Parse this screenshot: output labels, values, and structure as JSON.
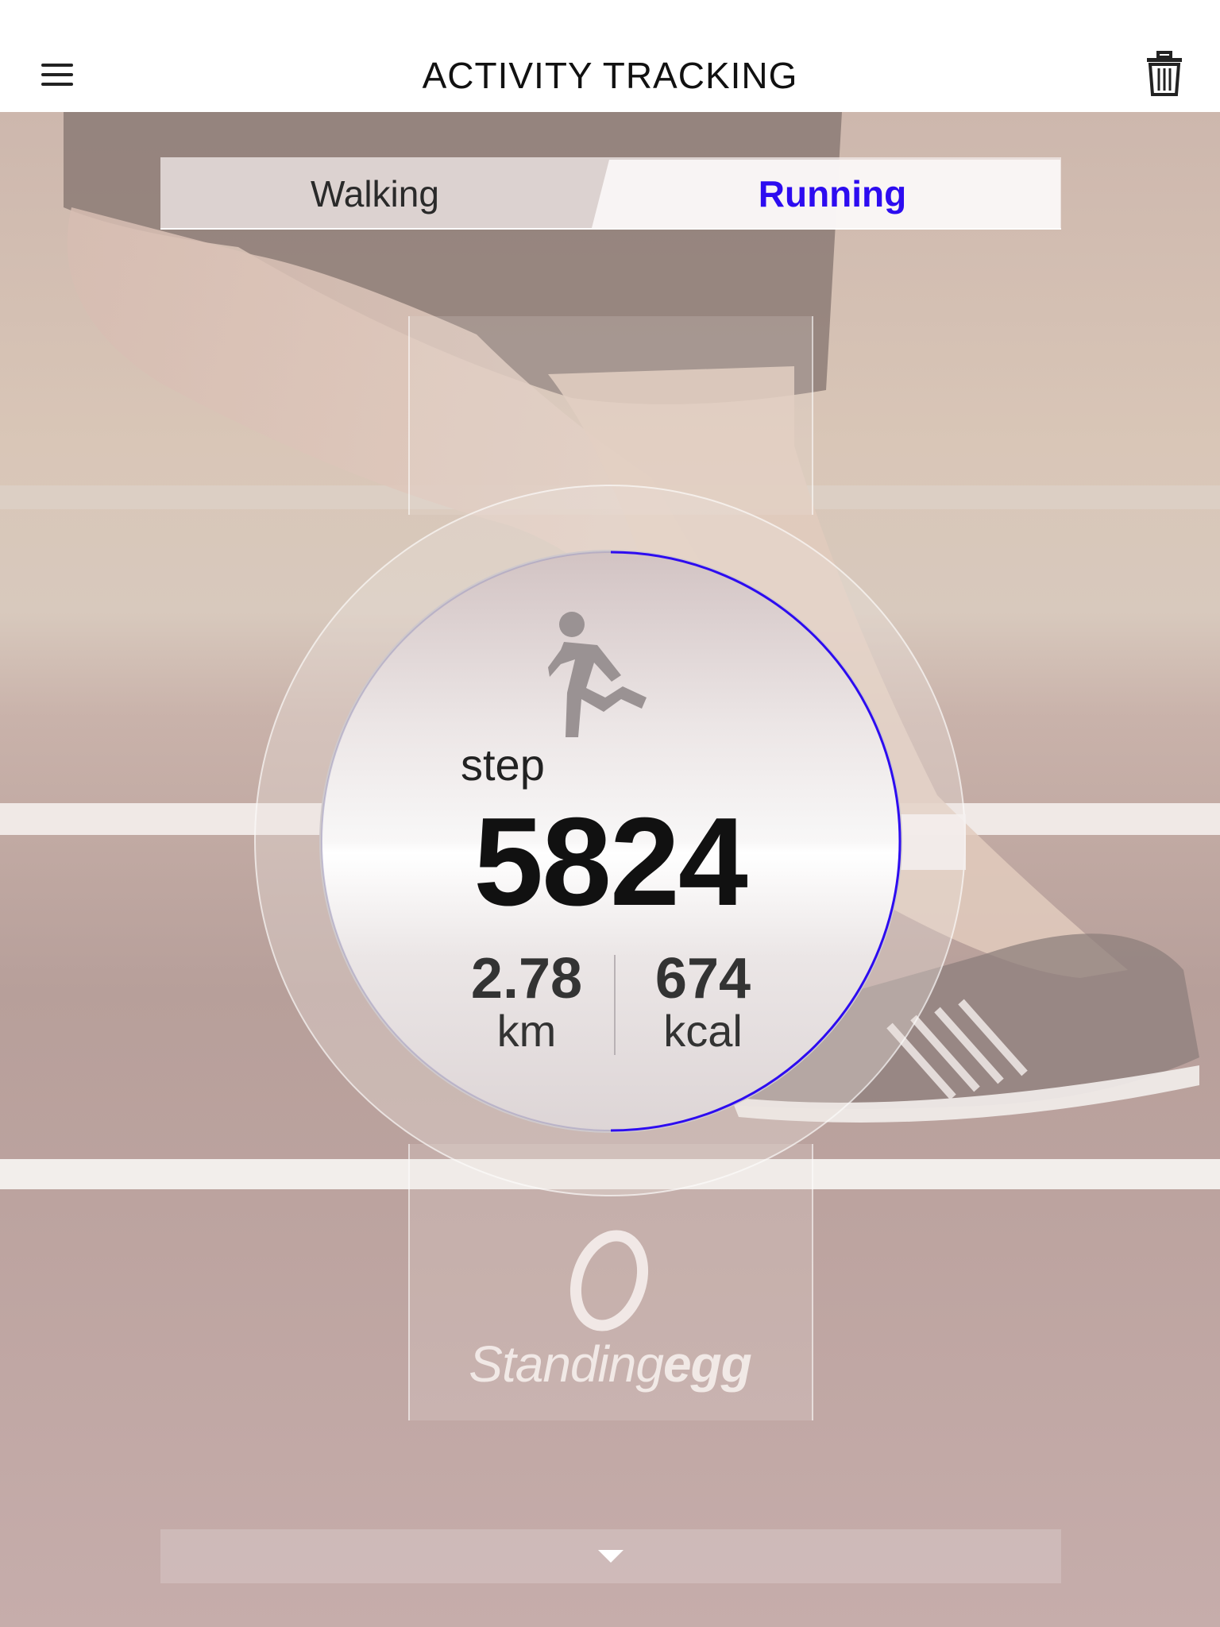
{
  "header": {
    "title": "ACTIVITY TRACKING",
    "menu_icon": "menu-icon",
    "trash_icon": "trash-icon"
  },
  "tabs": [
    {
      "label": "Walking",
      "active": false
    },
    {
      "label": "Running",
      "active": true
    }
  ],
  "colors": {
    "accent": "#2d0cf0",
    "text_dark": "#111111",
    "header_bg": "#ffffff"
  },
  "activity": {
    "icon": "running-person-icon",
    "step_label": "step",
    "step_value": "5824",
    "distance": {
      "value": "2.78",
      "unit": "km"
    },
    "calories": {
      "value": "674",
      "unit": "kcal"
    }
  },
  "brand": {
    "name_light": "Standing",
    "name_bold": "egg"
  },
  "bottom": {
    "icon": "chevron-down-icon"
  }
}
